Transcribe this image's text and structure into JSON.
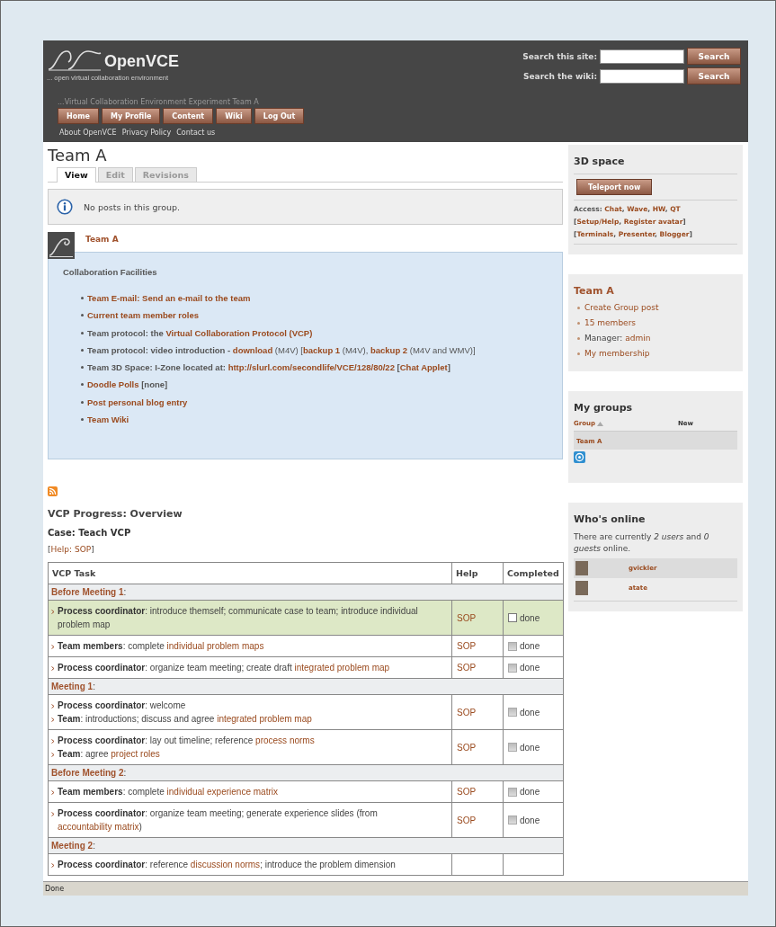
{
  "header": {
    "logo_text": "OpenVCE",
    "tagline": "... open virtual collaboration environment",
    "site_subtitle": "...Virtual Collaboration Environment Experiment Team A",
    "searches": [
      {
        "label": "Search this site:",
        "button": "Search"
      },
      {
        "label": "Search the wiki:",
        "button": "Search"
      }
    ],
    "nav": [
      "Home",
      "My Profile",
      "Content",
      "Wiki",
      "Log Out"
    ],
    "secondary_links": [
      "About OpenVCE",
      "Privacy Policy",
      "Contact us"
    ]
  },
  "page": {
    "title": "Team A",
    "tabs": [
      {
        "label": "View",
        "selected": true
      },
      {
        "label": "Edit",
        "selected": false
      },
      {
        "label": "Revisions",
        "selected": false
      }
    ],
    "message": "No posts in this group.",
    "group_link": "Team A",
    "facilities": {
      "heading": "Collaboration Facilities",
      "items": [
        [
          {
            "link": "Team E-mail: Send an e-mail to the team"
          }
        ],
        [
          {
            "link": "Current team member roles"
          }
        ],
        [
          "Team protocol: the ",
          {
            "link": "Virtual Collaboration Protocol (VCP)"
          }
        ],
        [
          "Team protocol: video introduction - ",
          {
            "link": "download"
          },
          {
            "note": " (M4V) ["
          },
          {
            "link": "backup 1"
          },
          {
            "note": " (M4V), "
          },
          {
            "link": "backup 2"
          },
          {
            "note": " (M4V and WMV)]"
          }
        ],
        [
          "Team 3D Space: I-Zone located at: ",
          {
            "link": "http://slurl.com/secondlife/VCE/128/80/22"
          },
          " [",
          {
            "link": "Chat Applet"
          },
          "]"
        ],
        [
          {
            "link": "Doodle Polls"
          },
          " [none]"
        ],
        [
          {
            "link": "Post personal blog entry"
          }
        ],
        [
          {
            "link": "Team Wiki"
          }
        ]
      ]
    },
    "progress": {
      "heading": "VCP Progress: Overview",
      "case": "Case: Teach VCP",
      "help": [
        "[",
        {
          "link": "Help: SOP"
        },
        "]"
      ],
      "columns": [
        "VCP Task",
        "Help",
        "Completed"
      ],
      "rows": [
        {
          "kind": "section",
          "label": "Before Meeting 1",
          "suffix": ":"
        },
        {
          "kind": "task",
          "highlighted": true,
          "lines": [
            [
              {
                "bold": "Process coordinator"
              },
              ": introduce themself; communicate case to team; introduce individual problem map"
            ]
          ],
          "help": "SOP",
          "checkbox": {
            "label": "done",
            "checked": false,
            "disabled": false
          }
        },
        {
          "kind": "task",
          "highlighted": false,
          "lines": [
            [
              {
                "bold": "Team members"
              },
              ": complete ",
              {
                "link": "individual problem maps"
              }
            ]
          ],
          "help": "SOP",
          "checkbox": {
            "label": "done",
            "checked": false,
            "disabled": true
          }
        },
        {
          "kind": "task",
          "highlighted": false,
          "lines": [
            [
              {
                "bold": "Process coordinator"
              },
              ": organize team meeting; create draft ",
              {
                "link": "integrated problem map"
              }
            ]
          ],
          "help": "SOP",
          "checkbox": {
            "label": "done",
            "checked": false,
            "disabled": true
          }
        },
        {
          "kind": "section",
          "label": "Meeting 1",
          "suffix": ":"
        },
        {
          "kind": "task",
          "highlighted": false,
          "lines": [
            [
              {
                "bold": "Process coordinator"
              },
              ": welcome"
            ],
            [
              {
                "bold": "Team"
              },
              ": introductions; discuss and agree ",
              {
                "link": "integrated problem map"
              }
            ]
          ],
          "help": "SOP",
          "checkbox": {
            "label": "done",
            "checked": false,
            "disabled": true
          }
        },
        {
          "kind": "task",
          "highlighted": false,
          "lines": [
            [
              {
                "bold": "Process coordinator"
              },
              ": lay out timeline; reference ",
              {
                "link": "process norms"
              }
            ],
            [
              {
                "bold": "Team"
              },
              ": agree ",
              {
                "link": "project roles"
              }
            ]
          ],
          "help": "SOP",
          "checkbox": {
            "label": "done",
            "checked": false,
            "disabled": true
          }
        },
        {
          "kind": "section",
          "label": "Before Meeting 2",
          "suffix": ":"
        },
        {
          "kind": "task",
          "highlighted": false,
          "lines": [
            [
              {
                "bold": "Team members"
              },
              ": complete ",
              {
                "link": "individual experience matrix"
              }
            ]
          ],
          "help": "SOP",
          "checkbox": {
            "label": "done",
            "checked": false,
            "disabled": true
          }
        },
        {
          "kind": "task",
          "highlighted": false,
          "lines": [
            [
              {
                "bold": "Process coordinator"
              },
              ": organize team meeting; generate experience slides (from ",
              {
                "link": "accountability matrix"
              },
              ")"
            ]
          ],
          "help": "SOP",
          "checkbox": {
            "label": "done",
            "checked": false,
            "disabled": true
          }
        },
        {
          "kind": "section",
          "label": "Meeting 2",
          "suffix": ":"
        },
        {
          "kind": "task",
          "highlighted": false,
          "lines": [
            [
              {
                "bold": "Process coordinator"
              },
              ": reference ",
              {
                "link": "discussion norms"
              },
              "; introduce the problem dimension"
            ]
          ]
        }
      ]
    }
  },
  "sidebar": {
    "space3d": {
      "title": "3D space",
      "button": "Teleport now",
      "lines": [
        [
          "Access: ",
          {
            "link": "Chat"
          },
          ", ",
          {
            "link": "Wave"
          },
          ", ",
          {
            "link": "HW"
          },
          ", ",
          {
            "link": "QT"
          }
        ],
        [
          "[",
          {
            "link": "Setup/Help"
          },
          ", ",
          {
            "link": "Register avatar"
          },
          "]"
        ],
        [
          "[",
          {
            "link": "Terminals"
          },
          ", ",
          {
            "link": "Presenter"
          },
          ", ",
          {
            "link": "Blogger"
          },
          "]"
        ]
      ]
    },
    "team": {
      "title": "Team A",
      "items": [
        [
          {
            "link": "Create Group post"
          }
        ],
        [
          {
            "link": "15 members"
          }
        ],
        [
          "Manager: ",
          {
            "link": "admin"
          }
        ],
        [
          {
            "link": "My membership"
          }
        ]
      ]
    },
    "my_groups": {
      "title": "My groups",
      "columns": [
        "Group",
        "New"
      ],
      "rows": [
        "Team A"
      ]
    },
    "whos_online": {
      "title": "Who's online",
      "text": "There are currently *2 users* and *0 guests* online.",
      "users": [
        "gvickler",
        "atate"
      ]
    }
  },
  "status_bar": "Done"
}
